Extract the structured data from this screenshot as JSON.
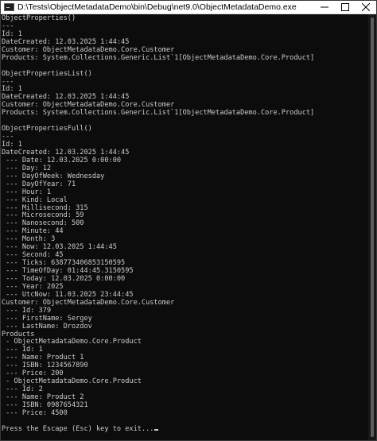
{
  "window": {
    "title": "D:\\Tests\\ObjectMetadataDemo\\bin\\Debug\\net9.0\\ObjectMetadataDemo.exe",
    "controls": {
      "minimize": "minimize-icon",
      "maximize": "maximize-icon",
      "close": "close-icon"
    }
  },
  "console": {
    "lines": [
      "ObjectProperties()",
      "---",
      "Id: 1",
      "DateCreated: 12.03.2025 1:44:45",
      "Customer: ObjectMetadataDemo.Core.Customer",
      "Products: System.Collections.Generic.List`1[ObjectMetadataDemo.Core.Product]",
      "",
      "ObjectPropertiesList()",
      "---",
      "Id: 1",
      "DateCreated: 12.03.2025 1:44:45",
      "Customer: ObjectMetadataDemo.Core.Customer",
      "Products: System.Collections.Generic.List`1[ObjectMetadataDemo.Core.Product]",
      "",
      "ObjectPropertiesFull()",
      "---",
      "Id: 1",
      "DateCreated: 12.03.2025 1:44:45",
      " --- Date: 12.03.2025 0:00:00",
      " --- Day: 12",
      " --- DayOfWeek: Wednesday",
      " --- DayOfYear: 71",
      " --- Hour: 1",
      " --- Kind: Local",
      " --- Millisecond: 315",
      " --- Microsecond: 59",
      " --- Nanosecond: 500",
      " --- Minute: 44",
      " --- Month: 3",
      " --- Now: 12.03.2025 1:44:45",
      " --- Second: 45",
      " --- Ticks: 638773406853150595",
      " --- TimeOfDay: 01:44:45.3150595",
      " --- Today: 12.03.2025 0:00:00",
      " --- Year: 2025",
      " --- UtcNow: 11.03.2025 23:44:45",
      "Customer: ObjectMetadataDemo.Core.Customer",
      " --- Id: 379",
      " --- FirstName: Sergey",
      " --- LastName: Drozdov",
      "Products",
      " - ObjectMetadataDemo.Core.Product",
      " --- Id: 1",
      " --- Name: Product 1",
      " --- ISBN: 1234567890",
      " --- Price: 200",
      " - ObjectMetadataDemo.Core.Product",
      " --- Id: 2",
      " --- Name: Product 2",
      " --- ISBN: 0987654321",
      " --- Price: 4500",
      "",
      "Press the Escape (Esc) key to exit..."
    ]
  },
  "colors": {
    "background": "#0c0c0c",
    "text": "#cccccc",
    "titlebar": "#ffffff"
  }
}
